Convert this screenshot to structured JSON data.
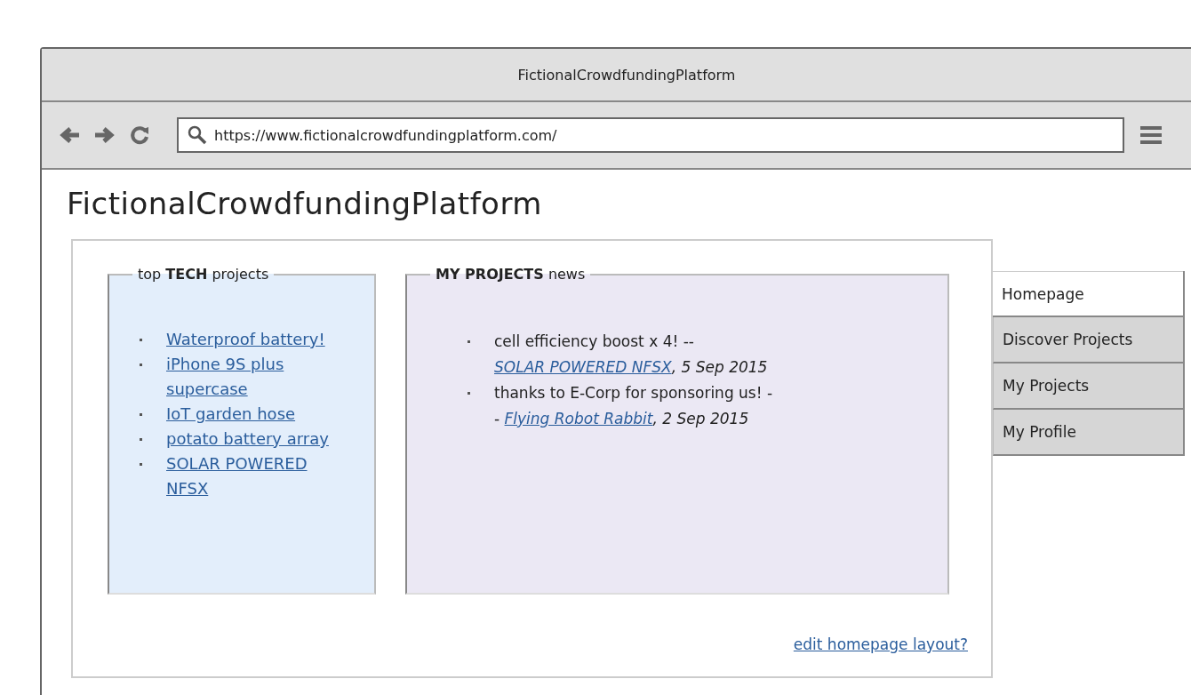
{
  "window": {
    "title": "FictionalCrowdfundingPlatform"
  },
  "toolbar": {
    "url": "https://www.fictionalcrowdfundingplatform.com/"
  },
  "page": {
    "title": "FictionalCrowdfundingPlatform"
  },
  "tech_projects": {
    "legend": "top **TECH** projects",
    "items": [
      {
        "label": "Waterproof battery!"
      },
      {
        "label": "iPhone 9S plus supercase"
      },
      {
        "label": "IoT garden hose"
      },
      {
        "label": "potato battery array"
      },
      {
        "label": "SOLAR POWERED NFSX"
      }
    ]
  },
  "news": {
    "legend": "**MY PROJECTS** news",
    "items": [
      {
        "text": "cell efficiency boost x 4! --",
        "link": "SOLAR POWERED NFSX",
        "date": ", 5 Sep 2015"
      },
      {
        "text": "thanks to E-Corp for sponsoring us! --",
        "link": "Flying Robot Rabbit",
        "date": ", 2 Sep 2015"
      }
    ]
  },
  "tabs": [
    {
      "label": "Homepage",
      "selected": true
    },
    {
      "label": "Discover Projects",
      "selected": false
    },
    {
      "label": "My Projects",
      "selected": false
    },
    {
      "label": "My Profile",
      "selected": false
    }
  ],
  "edit_link": "edit homepage layout?"
}
